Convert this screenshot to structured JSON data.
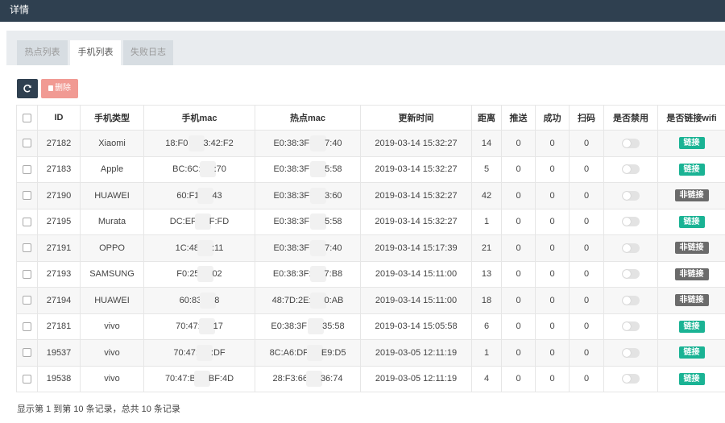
{
  "window": {
    "title": "详情"
  },
  "tabs": [
    {
      "label": "热点列表",
      "active": false
    },
    {
      "label": "手机列表",
      "active": true
    },
    {
      "label": "失败日志",
      "active": false
    }
  ],
  "toolbar": {
    "refresh_icon": "refresh-icon",
    "delete_label": "删除",
    "delete_icon": "trash-icon"
  },
  "table": {
    "columns": [
      "",
      "ID",
      "手机类型",
      "手机mac",
      "热点mac",
      "更新时间",
      "距离",
      "推送",
      "成功",
      "扫码",
      "是否禁用",
      "是否链接wifi"
    ],
    "rows": [
      {
        "id": "27182",
        "type": "Xiaomi",
        "mac_a": "18:F0:",
        "mac_b": "3:42:F2",
        "hot_a": "E0:38:3F:",
        "hot_b": "7:40",
        "time": "2019-03-14 15:32:27",
        "dist": "14",
        "push": "0",
        "succ": "0",
        "scan": "0",
        "link": "链接",
        "linked": true
      },
      {
        "id": "27183",
        "type": "Apple",
        "mac_a": "BC:6C:",
        "mac_b": ":70",
        "hot_a": "E0:38:3F:",
        "hot_b": "5:58",
        "time": "2019-03-14 15:32:27",
        "dist": "5",
        "push": "0",
        "succ": "0",
        "scan": "0",
        "link": "链接",
        "linked": true
      },
      {
        "id": "27190",
        "type": "HUAWEI",
        "mac_a": "60:F1",
        "mac_b": "43",
        "hot_a": "E0:38:3F:",
        "hot_b": "3:60",
        "time": "2019-03-14 15:32:27",
        "dist": "42",
        "push": "0",
        "succ": "0",
        "scan": "0",
        "link": "非链接",
        "linked": false
      },
      {
        "id": "27195",
        "type": "Murata",
        "mac_a": "DC:EF",
        "mac_b": "F:FD",
        "hot_a": "E0:38:3F:",
        "hot_b": "5:58",
        "time": "2019-03-14 15:32:27",
        "dist": "1",
        "push": "0",
        "succ": "0",
        "scan": "0",
        "link": "链接",
        "linked": true
      },
      {
        "id": "27191",
        "type": "OPPO",
        "mac_a": "1C:48",
        "mac_b": ":11",
        "hot_a": "E0:38:3F:",
        "hot_b": "7:40",
        "time": "2019-03-14 15:17:39",
        "dist": "21",
        "push": "0",
        "succ": "0",
        "scan": "0",
        "link": "非链接",
        "linked": false
      },
      {
        "id": "27193",
        "type": "SAMSUNG",
        "mac_a": "F0:25",
        "mac_b": "02",
        "hot_a": "E0:38:3F:",
        "hot_b": "7:B8",
        "time": "2019-03-14 15:11:00",
        "dist": "13",
        "push": "0",
        "succ": "0",
        "scan": "0",
        "link": "非链接",
        "linked": false
      },
      {
        "id": "27194",
        "type": "HUAWEI",
        "mac_a": "60:83",
        "mac_b": "8",
        "hot_a": "48:7D:2E:",
        "hot_b": "0:AB",
        "time": "2019-03-14 15:11:00",
        "dist": "18",
        "push": "0",
        "succ": "0",
        "scan": "0",
        "link": "非链接",
        "linked": false
      },
      {
        "id": "27181",
        "type": "vivo",
        "mac_a": "70:47:",
        "mac_b": "17",
        "hot_a": "E0:38:3F:",
        "hot_b": "35:58",
        "time": "2019-03-14 15:05:58",
        "dist": "6",
        "push": "0",
        "succ": "0",
        "scan": "0",
        "link": "链接",
        "linked": true
      },
      {
        "id": "19537",
        "type": "vivo",
        "mac_a": "70:47:",
        "mac_b": ":DF",
        "hot_a": "8C:A6:DF",
        "hot_b": "E9:D5",
        "time": "2019-03-05 12:11:19",
        "dist": "1",
        "push": "0",
        "succ": "0",
        "scan": "0",
        "link": "链接",
        "linked": true
      },
      {
        "id": "19538",
        "type": "vivo",
        "mac_a": "70:47:B",
        "mac_b": "BF:4D",
        "hot_a": "28:F3:66",
        "hot_b": "36:74",
        "time": "2019-03-05 12:11:19",
        "dist": "4",
        "push": "0",
        "succ": "0",
        "scan": "0",
        "link": "链接",
        "linked": true
      }
    ]
  },
  "footer": {
    "summary": "显示第 1 到第 10 条记录，总共 10 条记录"
  },
  "colors": {
    "topbar": "#2f4050",
    "linked": "#1ab394",
    "unlinked": "#6b6b6b",
    "delete": "#f19a93"
  }
}
